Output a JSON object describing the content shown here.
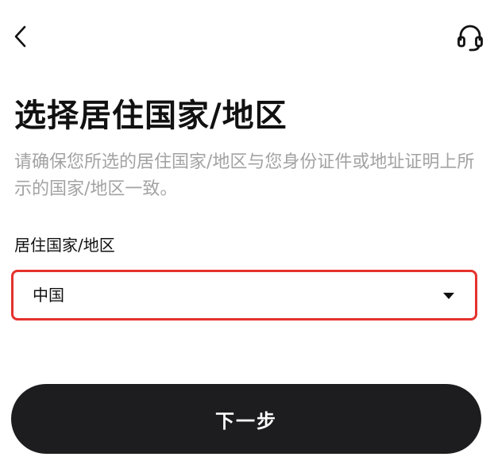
{
  "header": {
    "back_icon": "chevron-left-icon",
    "support_icon": "headset-icon"
  },
  "title": "选择居住国家/地区",
  "description": "请确保您所选的居住国家/地区与您身份证件或地址证明上所示的国家/地区一致。",
  "form": {
    "field_label": "居住国家/地区",
    "selected_country": "中国",
    "highlight_color": "#e5322d"
  },
  "actions": {
    "next_label": "下一步",
    "button_color": "#1d1d1f"
  }
}
